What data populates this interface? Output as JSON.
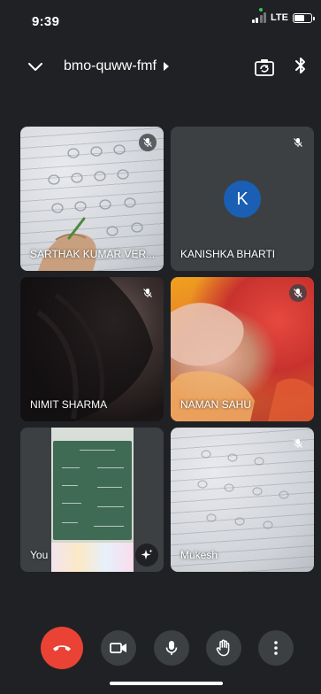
{
  "status_bar": {
    "time": "9:39",
    "network": "LTE"
  },
  "header": {
    "meeting_code": "bmo-quww-fmf"
  },
  "tiles": [
    {
      "name": "SARTHAK KUMAR VER...",
      "muted": true
    },
    {
      "name": "KANISHKA BHARTI",
      "muted": true,
      "avatar_initial": "K"
    },
    {
      "name": "NIMIT SHARMA",
      "muted": true
    },
    {
      "name": "NAMAN SAHU",
      "muted": true
    },
    {
      "name": "You",
      "muted": false
    },
    {
      "name": "Mukesh",
      "muted": true
    }
  ],
  "colors": {
    "background": "#202124",
    "tile_bg": "#3c4043",
    "end_call": "#ea4335",
    "avatar_k": "#1a5fb4"
  },
  "icons": {
    "collapse": "chevron-down-icon",
    "camera_switch": "camera-switch-icon",
    "audio": "bluetooth-icon",
    "tile_mic": "mic-off-icon",
    "effects": "sparkle-icon",
    "end_call": "phone-hangup-icon",
    "camera": "video-camera-icon",
    "mic": "microphone-icon",
    "raise_hand": "hand-icon",
    "more": "more-vertical-icon"
  }
}
